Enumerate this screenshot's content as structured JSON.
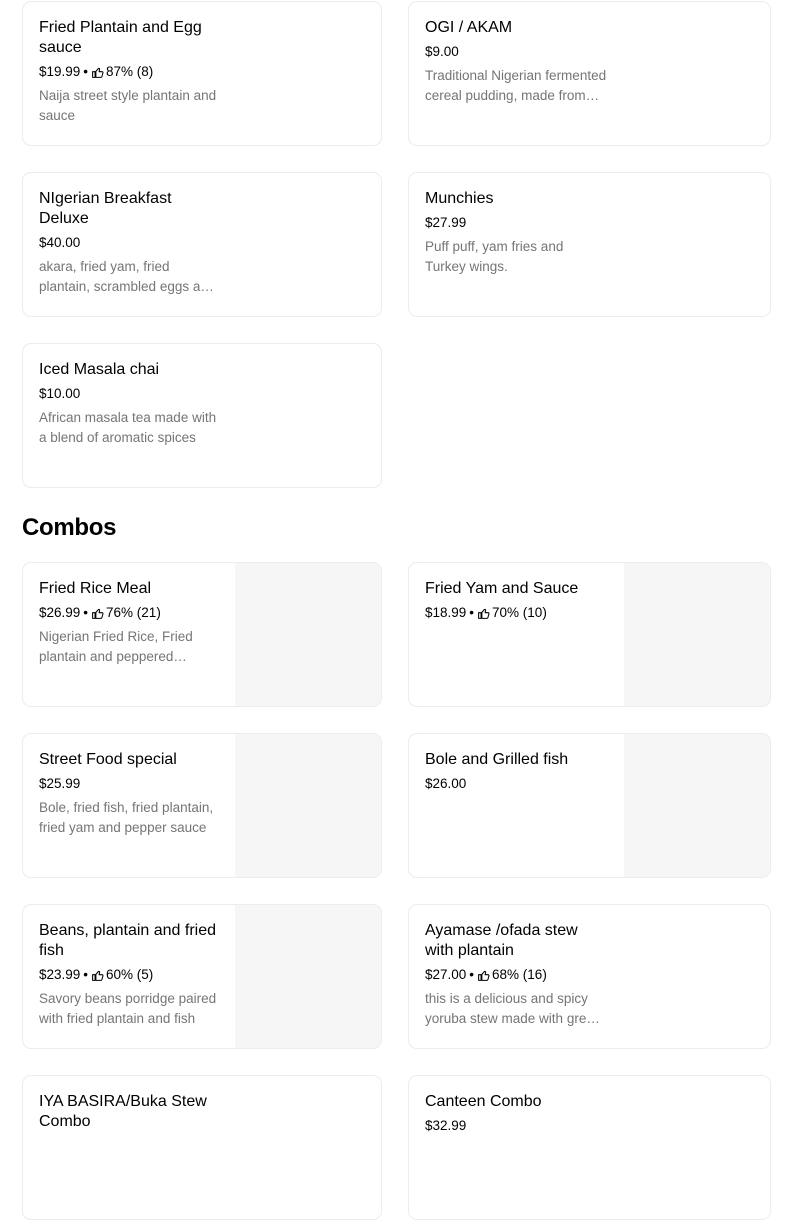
{
  "top_items": [
    {
      "title": "Fried Plantain and Egg sauce",
      "price": "$19.99",
      "rating": "87% (8)",
      "description": "Naija street style plantain and sauce"
    },
    {
      "title": "OGI / AKAM",
      "price": "$9.00",
      "rating": "",
      "description": "Traditional Nigerian fermented cereal pudding, made from maize, sorghum or millet"
    },
    {
      "title": "NIgerian Breakfast Deluxe",
      "price": "$40.00",
      "rating": "",
      "description": "akara, fried yam, fried plantain, scrambled eggs and sauce"
    },
    {
      "title": "Munchies",
      "price": "$27.99",
      "rating": "",
      "description": "Puff puff, yam fries and Turkey wings."
    },
    {
      "title": "Iced Masala chai",
      "price": "$10.00",
      "rating": "",
      "description": "African masala tea made with a blend of aromatic spices"
    }
  ],
  "combos_section": {
    "title": "Combos",
    "items": [
      {
        "title": "Fried Rice Meal",
        "price": "$26.99",
        "rating": "76% (21)",
        "description": "Nigerian Fried Rice, Fried plantain and peppered chicken"
      },
      {
        "title": "Fried Yam and Sauce",
        "price": "$18.99",
        "rating": "70% (10)",
        "description": ""
      },
      {
        "title": "Street Food special",
        "price": "$25.99",
        "rating": "",
        "description": "Bole, fried fish, fried plantain, fried yam and pepper sauce"
      },
      {
        "title": "Bole and Grilled fish",
        "price": "$26.00",
        "rating": "",
        "description": ""
      },
      {
        "title": "Beans, plantain and fried fish",
        "price": "$23.99",
        "rating": "60% (5)",
        "description": "Savory beans porridge paired with fried plantain and fish"
      },
      {
        "title": "Ayamase /ofada stew with plantain",
        "price": "$27.00",
        "rating": "68% (16)",
        "description": "this is a delicious and spicy yoruba stew made with green peppers"
      },
      {
        "title": "IYA BASIRA/Buka Stew Combo",
        "price": "",
        "rating": "",
        "description": ""
      },
      {
        "title": "Canteen Combo",
        "price": "$32.99",
        "rating": "",
        "description": ""
      }
    ]
  },
  "icons": {
    "rating": "thumbs-up-icon"
  },
  "colors": {
    "text": "#000000",
    "muted": "#757575",
    "border": "#ececec",
    "image_placeholder": "#f6f6f6"
  }
}
